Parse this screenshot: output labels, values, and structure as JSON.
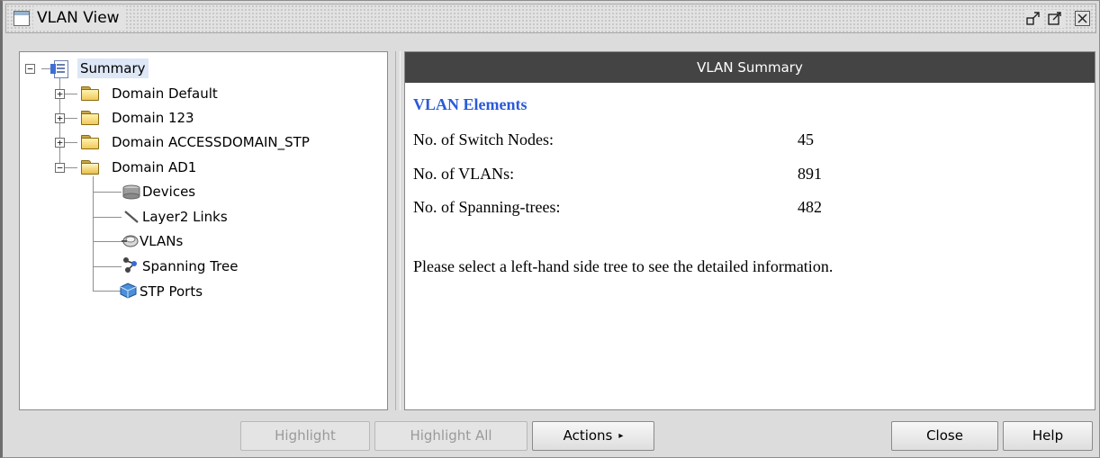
{
  "window": {
    "title": "VLAN View",
    "controls": {
      "restore": "restore-icon",
      "maximize": "maximize-icon",
      "close": "close-icon"
    }
  },
  "tree": {
    "root": {
      "label": "Summary",
      "expander": "⊟",
      "icon": "summary-icon"
    },
    "domains": [
      {
        "label": "Domain Default",
        "expander": "+",
        "icon": "folder-closed-icon"
      },
      {
        "label": "Domain 123",
        "expander": "+",
        "icon": "folder-closed-icon"
      },
      {
        "label": "Domain ACCESSDOMAIN_STP",
        "expander": "+",
        "icon": "folder-closed-icon"
      },
      {
        "label": "Domain AD1",
        "expander": "−",
        "icon": "folder-open-icon"
      }
    ],
    "children": [
      {
        "label": "Devices",
        "icon": "devices-icon"
      },
      {
        "label": "Layer2 Links",
        "icon": "link-icon"
      },
      {
        "label": "VLANs",
        "icon": "vlan-icon"
      },
      {
        "label": "Spanning Tree",
        "icon": "spanning-tree-icon"
      },
      {
        "label": "STP Ports",
        "icon": "stp-port-icon"
      }
    ]
  },
  "summary": {
    "header": "VLAN Summary",
    "heading": "VLAN Elements",
    "rows": [
      {
        "label": "No. of Switch Nodes:",
        "value": "45"
      },
      {
        "label": "No. of VLANs:",
        "value": "891"
      },
      {
        "label": "No. of Spanning-trees:",
        "value": "482"
      }
    ],
    "hint": "Please select a left-hand side tree to see the detailed information."
  },
  "buttons": {
    "highlight": "Highlight",
    "highlight_all": "Highlight All",
    "actions": "Actions",
    "actions_arrow": "▸",
    "close": "Close",
    "help": "Help"
  },
  "colors": {
    "header_bg": "#444444",
    "heading": "#2a5ad9",
    "selection": "#dde7f5"
  }
}
